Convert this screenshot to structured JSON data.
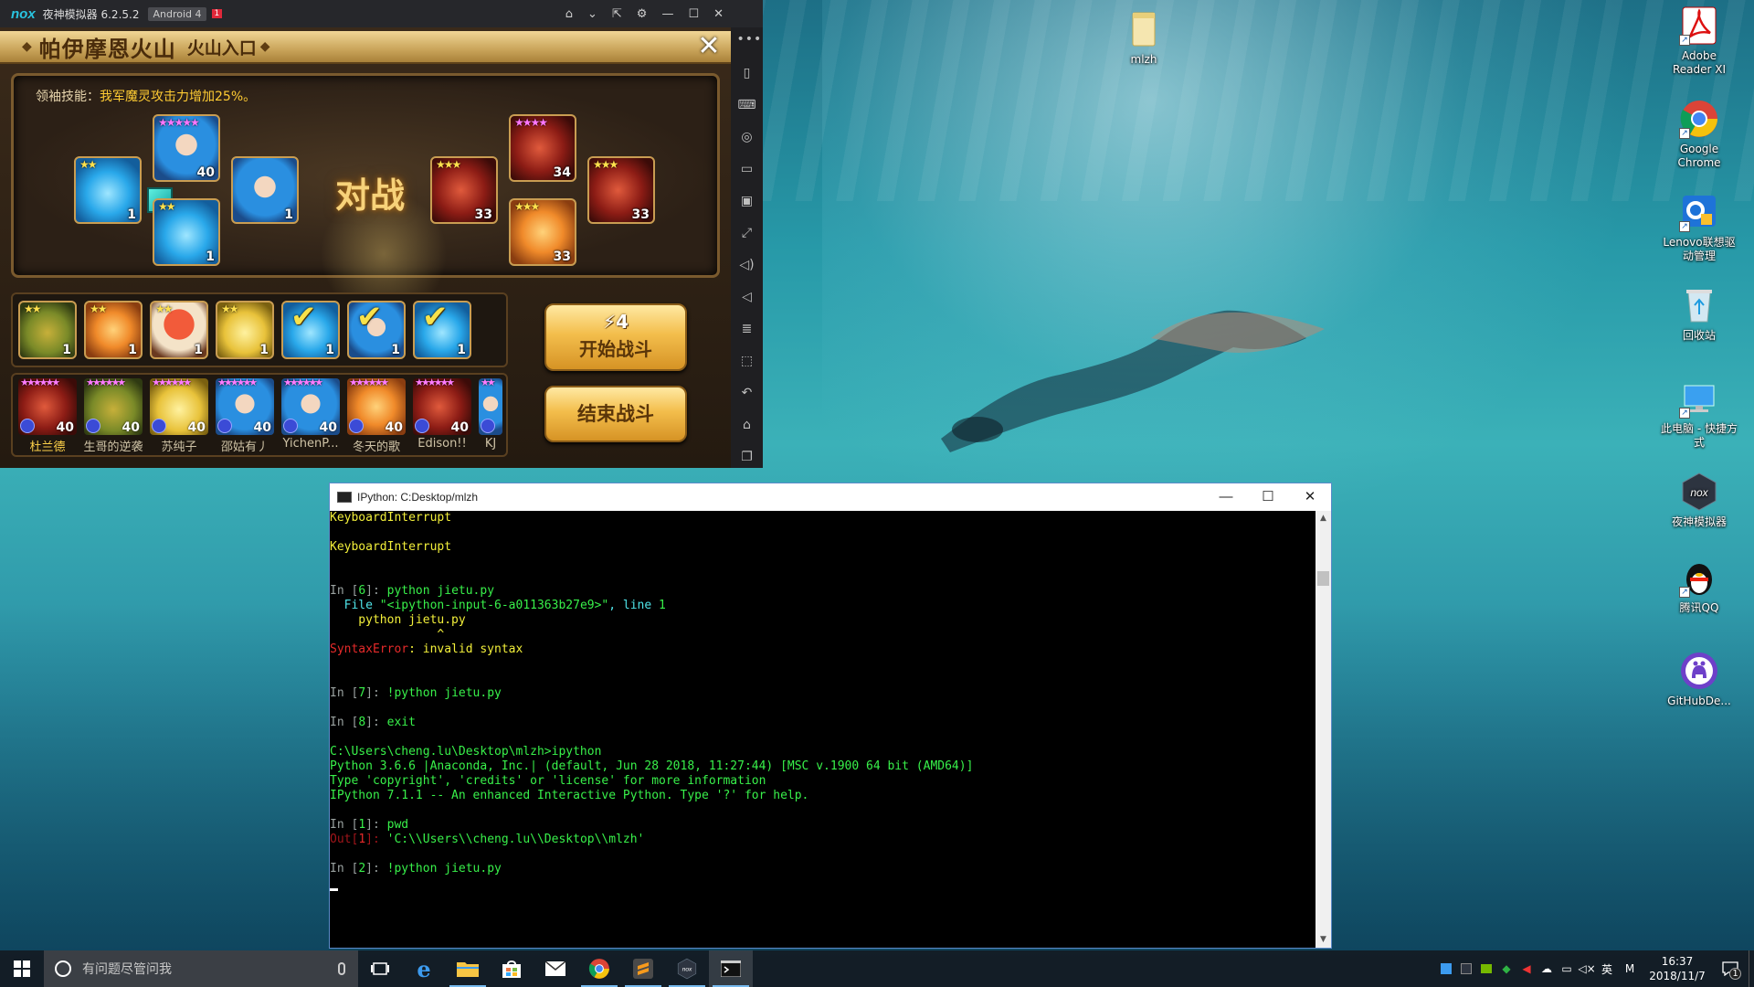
{
  "emulator": {
    "logo": "nox",
    "title": "夜神模拟器 6.2.5.2",
    "android_badge": "Android 4",
    "alert_badge": "1",
    "title_controls": [
      "home-icon",
      "chevron-down-icon",
      "pin-icon",
      "gear-icon",
      "minimize-icon",
      "maximize-icon",
      "close-icon"
    ],
    "sidebar_top": "•••",
    "sidebar_bottom": "»"
  },
  "game": {
    "header": {
      "title": "帕伊摩恩火山",
      "subtitle": "火山入口",
      "close": "✕"
    },
    "leader_skill": {
      "label": "领袖技能：",
      "text": "我军魔灵攻击力增加25%。"
    },
    "vs_label": "对战",
    "my_team": [
      {
        "stars": "★★",
        "level": "1"
      },
      {
        "stars": "★★★★★",
        "level": "40"
      },
      {
        "stars": "★★",
        "level": "1"
      },
      {
        "stars": "",
        "level": "1"
      }
    ],
    "enemy_team": [
      {
        "stars": "★★★",
        "level": "33"
      },
      {
        "stars": "★★★★",
        "level": "34"
      },
      {
        "stars": "★★★",
        "level": "33"
      },
      {
        "stars": "★★★",
        "level": "33"
      }
    ],
    "roster": [
      {
        "stars": "★★",
        "level": "1",
        "selected": false
      },
      {
        "stars": "★★",
        "level": "1",
        "selected": false
      },
      {
        "stars": "★★",
        "level": "1",
        "selected": false
      },
      {
        "stars": "★★",
        "level": "1",
        "selected": false
      },
      {
        "stars": "",
        "level": "1",
        "selected": true
      },
      {
        "stars": "",
        "level": "1",
        "selected": true
      },
      {
        "stars": "",
        "level": "1",
        "selected": true
      }
    ],
    "friends": [
      {
        "name": "杜兰德",
        "level": "40"
      },
      {
        "name": "生哥的逆袭",
        "level": "40"
      },
      {
        "name": "苏纯子",
        "level": "40"
      },
      {
        "name": "邵姑有丿",
        "level": "40"
      },
      {
        "name": "YichenP...",
        "level": "40"
      },
      {
        "name": "冬天的歌",
        "level": "40"
      },
      {
        "name": "Edison!!",
        "level": "40"
      },
      {
        "name": "KJ",
        "level": ""
      }
    ],
    "start_button": {
      "energy": "4",
      "label": "开始战斗"
    },
    "end_button": "结束战斗"
  },
  "console": {
    "title": "IPython: C:Desktop/mlzh",
    "lines": [
      [
        {
          "t": "KeyboardInterrupt",
          "c": "c-yellow"
        }
      ],
      [],
      [
        {
          "t": "KeyboardInterrupt",
          "c": "c-yellow"
        }
      ],
      [],
      [],
      [
        {
          "t": "In [",
          "c": "c-grey"
        },
        {
          "t": "6",
          "c": "c-green"
        },
        {
          "t": "]: ",
          "c": "c-grey"
        },
        {
          "t": "python jietu.py",
          "c": "c-green"
        }
      ],
      [
        {
          "t": "  File ",
          "c": "c-cyan"
        },
        {
          "t": "\"<ipython-input-6-a011363b27e9>\"",
          "c": "c-green"
        },
        {
          "t": ", line ",
          "c": "c-cyan"
        },
        {
          "t": "1",
          "c": "c-green"
        }
      ],
      [
        {
          "t": "    python jietu.py",
          "c": "c-yellow"
        }
      ],
      [
        {
          "t": "               ^",
          "c": "c-yellow"
        }
      ],
      [
        {
          "t": "SyntaxError",
          "c": "c-red"
        },
        {
          "t": ": invalid syntax",
          "c": "c-yellow"
        }
      ],
      [],
      [],
      [
        {
          "t": "In [",
          "c": "c-grey"
        },
        {
          "t": "7",
          "c": "c-green"
        },
        {
          "t": "]: ",
          "c": "c-grey"
        },
        {
          "t": "!python jietu.py",
          "c": "c-green"
        }
      ],
      [],
      [
        {
          "t": "In [",
          "c": "c-grey"
        },
        {
          "t": "8",
          "c": "c-green"
        },
        {
          "t": "]: ",
          "c": "c-grey"
        },
        {
          "t": "exit",
          "c": "c-green"
        }
      ],
      [],
      [
        {
          "t": "C:\\Users\\cheng.lu\\Desktop\\mlzh>ipython",
          "c": "c-green"
        }
      ],
      [
        {
          "t": "Python 3.6.6 |Anaconda, Inc.| (default, Jun 28 2018, 11:27:44) [MSC v.1900 64 bit (AMD64)]",
          "c": "c-green"
        }
      ],
      [
        {
          "t": "Type 'copyright', 'credits' or 'license' for more information",
          "c": "c-green"
        }
      ],
      [
        {
          "t": "IPython 7.1.1 -- An enhanced Interactive Python. Type '?' for help.",
          "c": "c-green"
        }
      ],
      [],
      [
        {
          "t": "In [",
          "c": "c-grey"
        },
        {
          "t": "1",
          "c": "c-green"
        },
        {
          "t": "]: ",
          "c": "c-grey"
        },
        {
          "t": "pwd",
          "c": "c-green"
        }
      ],
      [
        {
          "t": "Out[",
          "c": "c-bred"
        },
        {
          "t": "1",
          "c": "c-red"
        },
        {
          "t": "]: ",
          "c": "c-bred"
        },
        {
          "t": "'C:\\\\Users\\\\cheng.lu\\\\Desktop\\\\mlzh'",
          "c": "c-green"
        }
      ],
      [],
      [
        {
          "t": "In [",
          "c": "c-grey"
        },
        {
          "t": "2",
          "c": "c-green"
        },
        {
          "t": "]: ",
          "c": "c-grey"
        },
        {
          "t": "!python jietu.py",
          "c": "c-green"
        }
      ],
      []
    ]
  },
  "desktop": {
    "icons": [
      {
        "label": "mlzh",
        "icon": "folder-icon"
      },
      {
        "label": "Adobe Reader XI",
        "icon": "adobe-reader-icon"
      },
      {
        "label": "Google Chrome",
        "icon": "chrome-icon"
      },
      {
        "label": "Lenovo联想驱动管理",
        "icon": "lenovo-driver-icon"
      },
      {
        "label": "回收站",
        "icon": "recycle-bin-icon"
      },
      {
        "label": "此电脑 - 快捷方式",
        "icon": "this-pc-icon"
      },
      {
        "label": "夜神模拟器",
        "icon": "nox-icon"
      },
      {
        "label": "腾讯QQ",
        "icon": "qq-icon"
      },
      {
        "label": "GitHubDe...",
        "icon": "github-desktop-icon"
      }
    ]
  },
  "taskbar": {
    "search_placeholder": "有问题尽管问我",
    "apps": [
      "task-view-icon",
      "edge-icon",
      "file-explorer-icon",
      "store-icon",
      "mail-icon",
      "chrome-icon",
      "sublime-icon",
      "nox-icon",
      "cmd-icon"
    ],
    "tray_ime": "英",
    "tray_m": "M",
    "time": "16:37",
    "date": "2018/11/7",
    "notification_count": "1"
  },
  "colors": {
    "console_bg": "#000000",
    "console_green": "#38f04a",
    "console_yellow": "#f2ef3a",
    "console_red": "#e62a2a",
    "nox_accent": "#29c4e0",
    "game_gold": "#f3be4c"
  }
}
